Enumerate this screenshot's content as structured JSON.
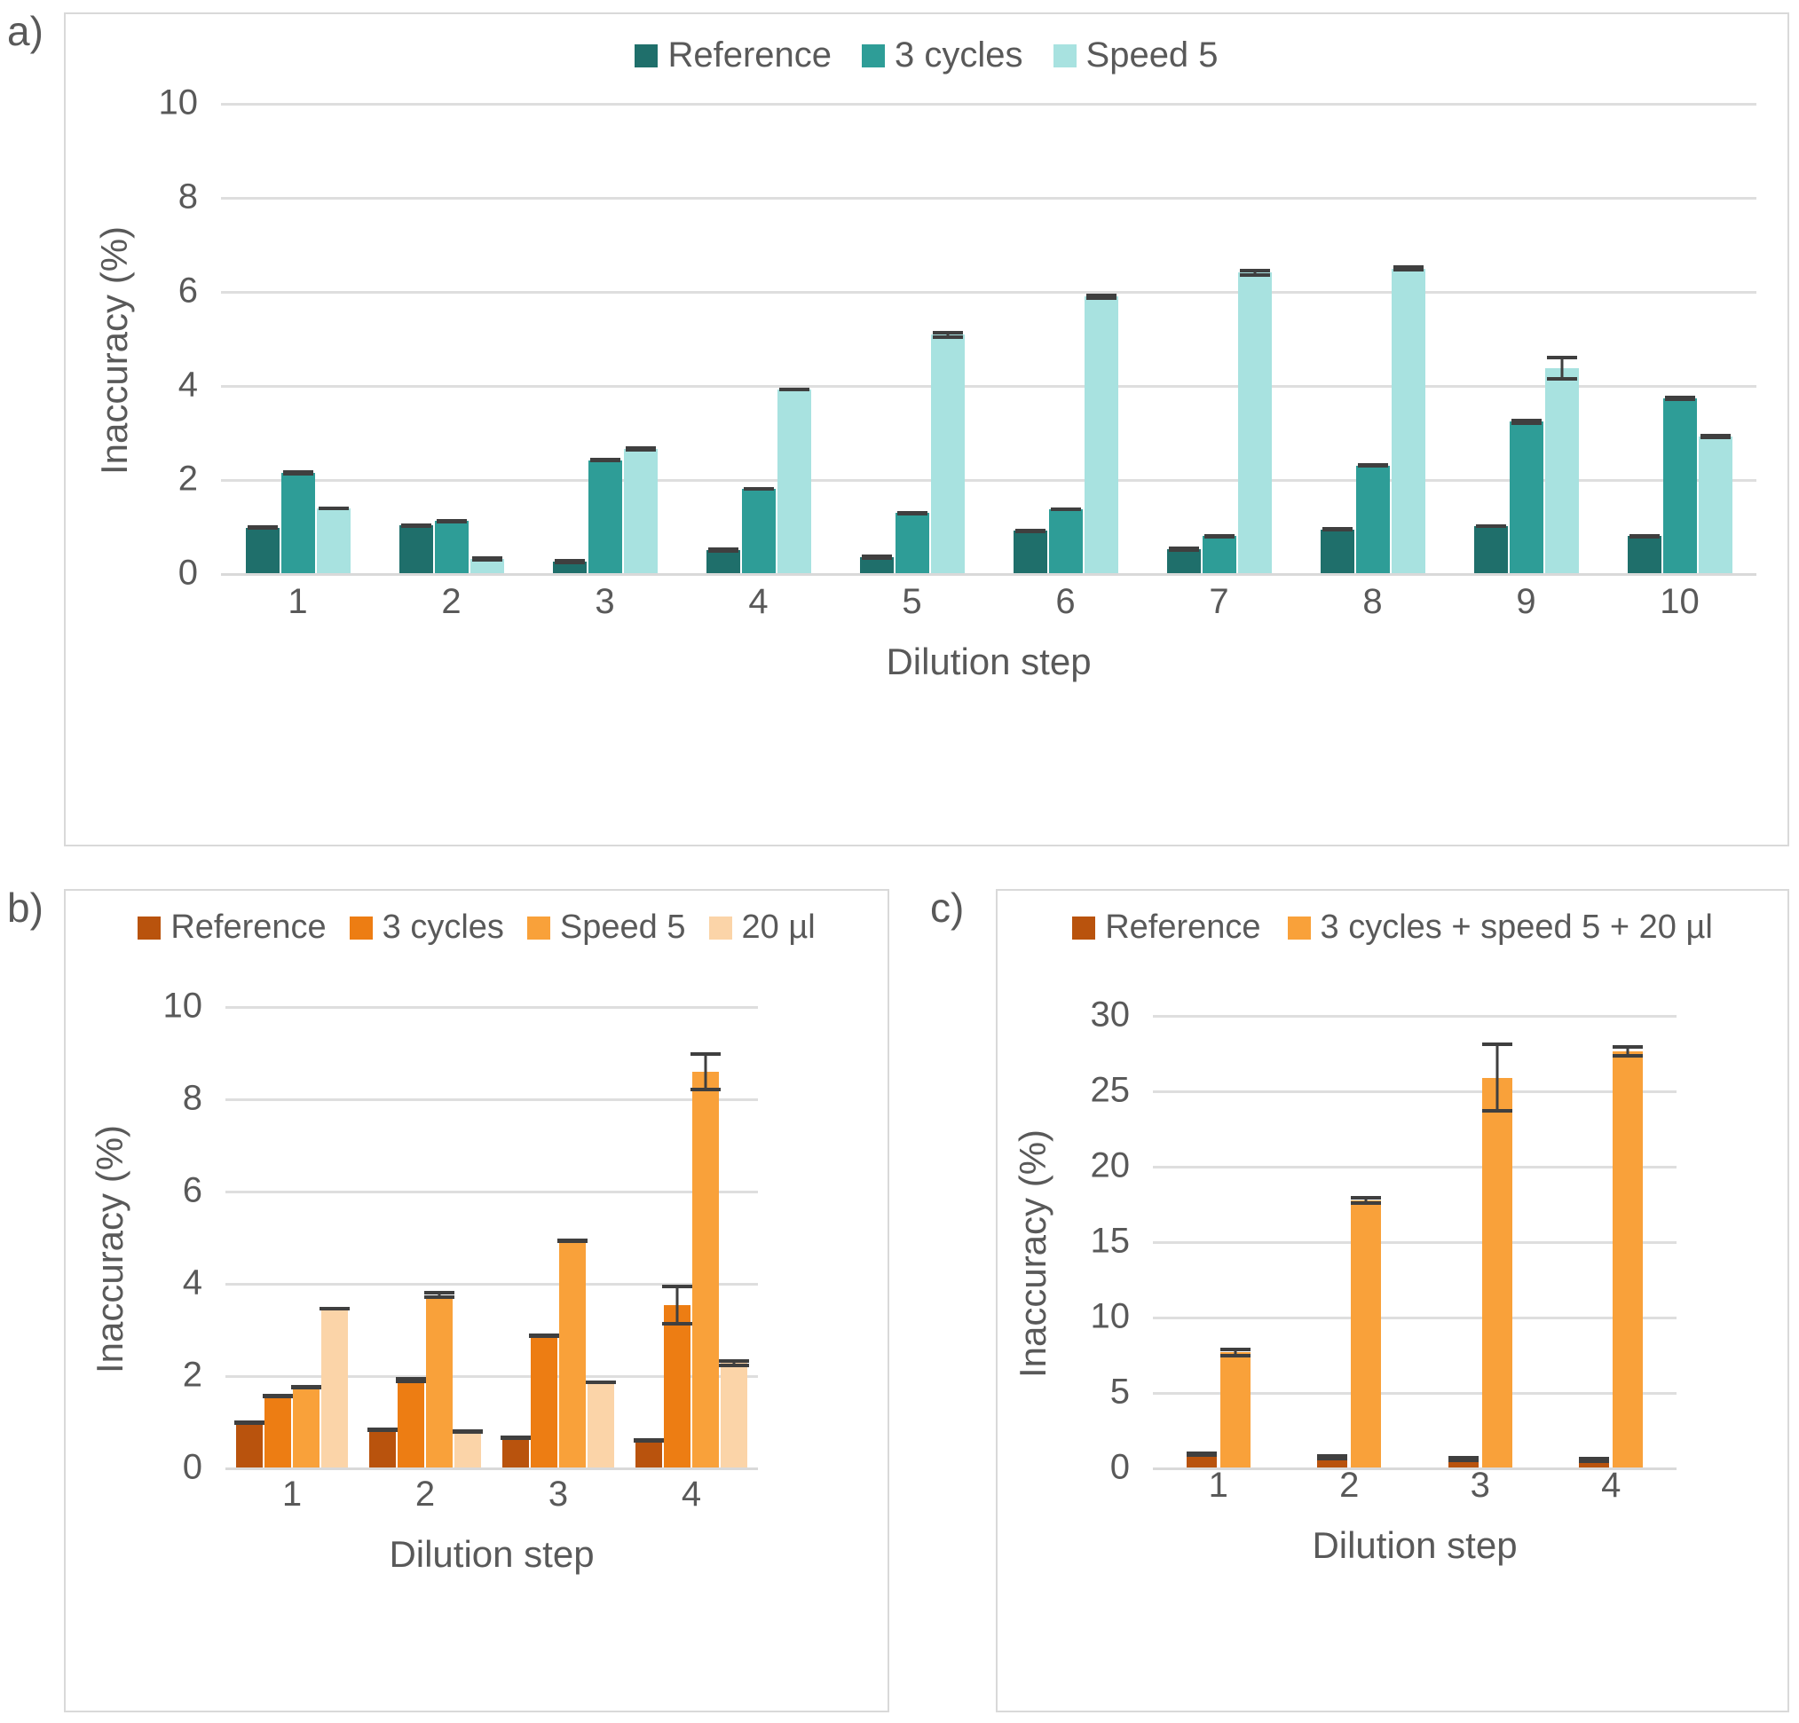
{
  "panels": {
    "a": {
      "letter": "a)",
      "legend": [
        {
          "label": "Reference",
          "color": "#1f6f6b"
        },
        {
          "label": "3 cycles",
          "color": "#2e9d97"
        },
        {
          "label": "Speed 5",
          "color": "#a8e2e0"
        }
      ]
    },
    "b": {
      "letter": "b)",
      "legend": [
        {
          "label": "Reference",
          "color": "#b9530d"
        },
        {
          "label": "3 cycles",
          "color": "#ed7d13"
        },
        {
          "label": "Speed 5",
          "color": "#f9a martial"
        },
        {
          "label": "20 µl",
          "color": "#fbd4a8"
        }
      ]
    },
    "c": {
      "letter": "c)",
      "legend": [
        {
          "label": "Reference",
          "color": "#b9530d"
        },
        {
          "label": "3 cycles + speed 5 + 20 µl",
          "color": "#f9a13a"
        }
      ]
    }
  },
  "chart_data": [
    {
      "panel": "a",
      "type": "bar",
      "title": "",
      "xlabel": "Dilution step",
      "ylabel": "Inaccuracy (%)",
      "categories": [
        "1",
        "2",
        "3",
        "4",
        "5",
        "6",
        "7",
        "8",
        "9",
        "10"
      ],
      "yticks": [
        0,
        2,
        4,
        6,
        8,
        10
      ],
      "ylim": [
        0,
        10
      ],
      "grid": true,
      "legend_position": "top",
      "colors": [
        "#1f6f6b",
        "#2e9d97",
        "#a8e2e0"
      ],
      "series": [
        {
          "name": "Reference",
          "values": [
            0.97,
            1.01,
            0.24,
            0.49,
            0.34,
            0.9,
            0.51,
            0.93,
            1.0,
            0.79
          ],
          "errors": [
            0.03,
            0.03,
            0.02,
            0.02,
            0.02,
            0.03,
            0.02,
            0.03,
            0.03,
            0.03
          ]
        },
        {
          "name": "3 cycles",
          "values": [
            2.13,
            1.11,
            2.4,
            1.8,
            1.28,
            1.36,
            0.79,
            2.29,
            3.22,
            3.72
          ],
          "errors": [
            0.05,
            0.03,
            0.05,
            0.04,
            0.03,
            0.04,
            0.03,
            0.05,
            0.06,
            0.05
          ]
        },
        {
          "name": "Speed 5",
          "values": [
            1.38,
            0.31,
            2.64,
            3.9,
            5.07,
            5.88,
            6.39,
            6.48,
            4.36,
            2.91
          ],
          "errors": [
            0.04,
            0.02,
            0.05,
            0.04,
            0.08,
            0.06,
            0.09,
            0.06,
            0.26,
            0.06
          ]
        }
      ]
    },
    {
      "panel": "b",
      "type": "bar",
      "title": "",
      "xlabel": "Dilution step",
      "ylabel": "Inaccuracy (%)",
      "categories": [
        "1",
        "2",
        "3",
        "4"
      ],
      "yticks": [
        0,
        2,
        4,
        6,
        8,
        10
      ],
      "ylim": [
        0,
        10
      ],
      "grid": true,
      "legend_position": "top",
      "colors": [
        "#b9530d",
        "#ed7d13",
        "#f9a13a",
        "#fbd4a8"
      ],
      "series": [
        {
          "name": "Reference",
          "values": [
            0.97,
            0.82,
            0.65,
            0.58
          ],
          "errors": [
            0.04,
            0.03,
            0.03,
            0.03
          ]
        },
        {
          "name": "3 cycles",
          "values": [
            1.55,
            1.9,
            2.85,
            3.52
          ],
          "errors": [
            0.05,
            0.07,
            0.05,
            0.45
          ]
        },
        {
          "name": "Speed 5",
          "values": [
            1.74,
            3.74,
            4.92,
            8.58
          ],
          "errors": [
            0.05,
            0.09,
            0.05,
            0.42
          ]
        },
        {
          "name": "20 µl",
          "values": [
            3.45,
            0.78,
            1.85,
            2.26
          ],
          "errors": [
            0.04,
            0.03,
            0.04,
            0.09
          ]
        }
      ]
    },
    {
      "panel": "c",
      "type": "bar",
      "title": "",
      "xlabel": "Dilution step",
      "ylabel": "Inaccuracy (%)",
      "categories": [
        "1",
        "2",
        "3",
        "4"
      ],
      "yticks": [
        0,
        5,
        10,
        15,
        20,
        25,
        30
      ],
      "ylim": [
        0,
        30
      ],
      "grid": true,
      "legend_position": "top",
      "colors": [
        "#b9530d",
        "#f9a13a"
      ],
      "series": [
        {
          "name": "Reference",
          "values": [
            0.9,
            0.68,
            0.55,
            0.5
          ],
          "errors": [
            0.05,
            0.04,
            0.03,
            0.03
          ]
        },
        {
          "name": "3 cycles + speed 5 + 20 µl",
          "values": [
            7.62,
            17.72,
            25.85,
            27.6
          ],
          "errors": [
            0.35,
            0.3,
            2.3,
            0.4
          ]
        }
      ]
    }
  ]
}
